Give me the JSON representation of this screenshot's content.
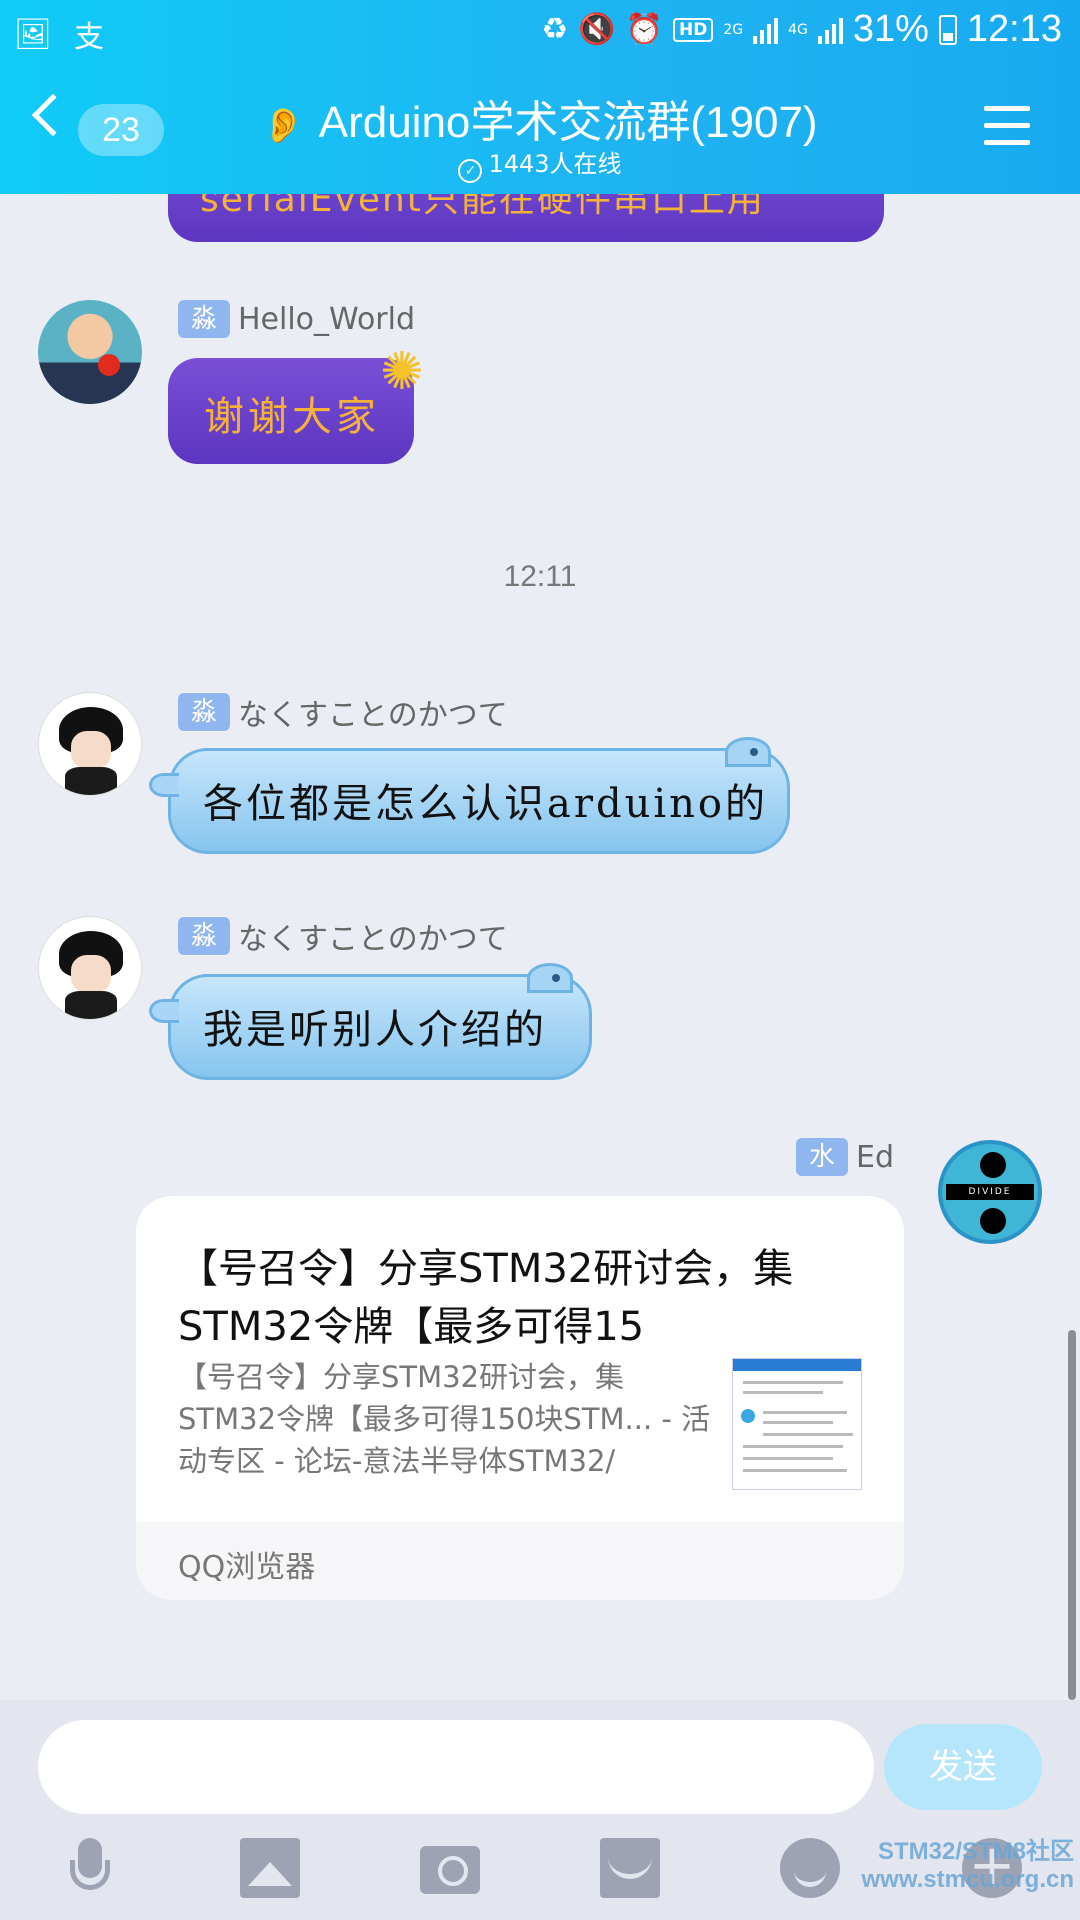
{
  "status_bar": {
    "battery": "31%",
    "time": "12:13",
    "network1": "2G",
    "network2": "4G",
    "hd": "HD"
  },
  "header": {
    "back_count": "23",
    "title": "Arduino学术交流群(1907)",
    "online": "1443人在线"
  },
  "messages": {
    "top_partial": "serialEvent只能在硬件串口上用",
    "msg1": {
      "sender": "Hello_World",
      "tag": "淼",
      "text": "谢谢大家"
    },
    "timestamp": "12:11",
    "msg2": {
      "sender": "なくすことのかつて",
      "tag": "淼",
      "text": "各位都是怎么认识arduino的"
    },
    "msg3": {
      "sender": "なくすことのかつて",
      "tag": "淼",
      "text": "我是听别人介绍的"
    },
    "msg4": {
      "sender": "Ed",
      "tag": "水",
      "card_title": "【号召令】分享STM32研讨会，集STM32令牌【最多可得15",
      "card_desc": "【号召令】分享STM32研讨会，集STM32令牌【最多可得150块STM... - 活动专区 - 论坛-意法半导体STM32/",
      "card_source": "QQ浏览器"
    }
  },
  "input_bar": {
    "placeholder": "",
    "send_label": "发送"
  },
  "watermark": {
    "line1": "STM32/STM8社区",
    "line2": "www.stmcu.org.cn"
  },
  "colors": {
    "header": "#1fb3f2",
    "bubble_blue": "#a9d6f6",
    "bubble_purple": "#6a42cc",
    "send": "#b5e6fb"
  }
}
